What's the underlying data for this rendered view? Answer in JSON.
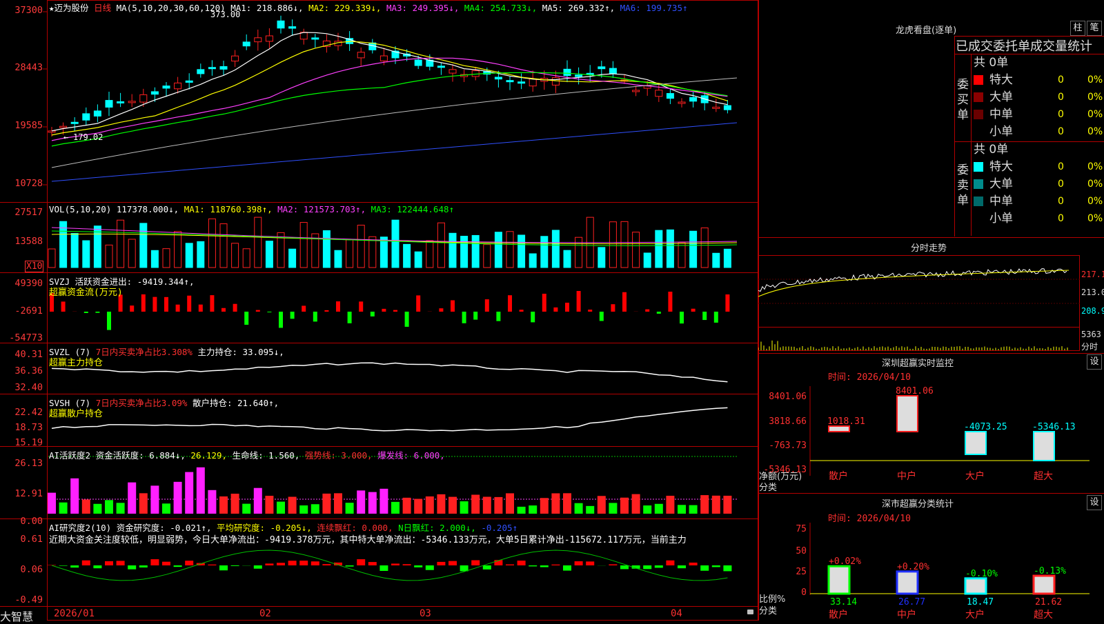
{
  "brand": "大智慧",
  "main": {
    "star": "★",
    "stock_name": "迈为股份",
    "period": "日线",
    "ma_formula": "MA(5,10,20,30,60,120)",
    "ma1": "MA1: 218.886↓,",
    "ma2": "MA2: 229.339↓,",
    "ma3": "MA3: 249.395↓,",
    "ma4": "MA4: 254.733↓,",
    "ma5": "MA5: 269.332↑,",
    "ma6": "MA6: 199.735↑",
    "high_mark": "373.00",
    "low_mark": "179.02",
    "yticks": [
      "37300",
      "28443",
      "19585",
      "10728"
    ]
  },
  "vol": {
    "title": "VOL(5,10,20)",
    "value": "117378.000↓,",
    "ma1": "MA1: 118760.398↑,",
    "ma2": "MA2: 121573.703↑,",
    "ma3": "MA3: 122444.648↑",
    "yticks": [
      "27517",
      "13588"
    ],
    "unit": "X10"
  },
  "svzj": {
    "title": "SVZJ",
    "label": "活跃资金进出: -9419.344↑,",
    "sub": "超赢资金流(万元)",
    "yticks": [
      "49390",
      "-2691",
      "-54773"
    ]
  },
  "svzl": {
    "title": "SVZL (7)",
    "red_label": "7日内买卖净占比3.308%",
    "label": "主力持仓: 33.095↓,",
    "sub": "超赢主力持仓",
    "yticks": [
      "40.31",
      "36.36",
      "32.40"
    ]
  },
  "svsh": {
    "title": "SVSH (7)",
    "red_label": "7日内买卖净占比3.09%",
    "label": "散户持仓: 21.640↑,",
    "sub": "超赢散户持仓",
    "yticks": [
      "22.42",
      "18.73",
      "15.19"
    ]
  },
  "ai1": {
    "title": "AI活跃度2",
    "label": "资金活跃度: 6.884↓,",
    "v2": "26.129,",
    "v3": "生命线: 1.560,",
    "v4": "强势线: 3.000,",
    "v5": "爆发线: 6.000,",
    "yticks": [
      "26.13",
      "12.91",
      "0.00"
    ]
  },
  "ai2": {
    "title": "AI研究度2(10)",
    "label": "资金研究度: -0.021↑,",
    "v2": "平均研究度: -0.205↓,",
    "v3": "连续飘红: 0.000,",
    "v4": "N日飘红: 2.000↓,",
    "v5": "-0.205↑",
    "yticks": [
      "0.61",
      "0.06",
      "-0.49"
    ],
    "comment": "近期大资金关注度较低，明显弱势，今日大单净流出：-9419.378万元，其中特大单净流出：-5346.133万元，大单5日累计净出-115672.117万元，当前主力"
  },
  "xaxis": [
    "2026/01",
    "02",
    "03",
    "04"
  ],
  "lhb": {
    "title": "龙虎看盘(逐单)",
    "btn1": "柱",
    "btn2": "笔",
    "header": "已成交委托单成交量统计",
    "buy_label": "委买单",
    "sell_label": "委卖单",
    "buy_total": "共 0单",
    "sell_total": "共 0单",
    "buy_rows": [
      {
        "name": "特大",
        "count": "0",
        "pct": "0%"
      },
      {
        "name": "大单",
        "count": "0",
        "pct": "0%"
      },
      {
        "name": "中单",
        "count": "0",
        "pct": "0%"
      },
      {
        "name": "小单",
        "count": "0",
        "pct": "0%"
      }
    ],
    "sell_rows": [
      {
        "name": "特大",
        "count": "0",
        "pct": "0%"
      },
      {
        "name": "大单",
        "count": "0",
        "pct": "0%"
      },
      {
        "name": "中单",
        "count": "0",
        "pct": "0%"
      },
      {
        "name": "小单",
        "count": "0",
        "pct": "0%"
      }
    ],
    "buy_colors": [
      "#ff0000",
      "#8b0000",
      "#6a0000",
      "#000000"
    ],
    "sell_colors": [
      "#00ffff",
      "#008b8b",
      "#006a6a",
      "#000000"
    ]
  },
  "fenshi": {
    "title": "分时走势",
    "yticks": [
      "217.1",
      "213.0",
      "208.9"
    ],
    "vol_tick": "5363",
    "vol_label": "分时"
  },
  "szmon": {
    "title": "深圳超赢实时监控",
    "btn": "设",
    "time": "时间: 2026/04/10",
    "yticks": [
      "8401.06",
      "3818.66",
      "-763.73",
      "-5346.13"
    ],
    "ylabel1": "净额(万元)",
    "ylabel2": "分类",
    "bars": [
      {
        "cat": "散户",
        "value": "1018.31"
      },
      {
        "cat": "中户",
        "value": "8401.06"
      },
      {
        "cat": "大户",
        "value": "-4073.25"
      },
      {
        "cat": "超大",
        "value": "-5346.13"
      }
    ]
  },
  "szcls": {
    "title": "深市超赢分类统计",
    "btn": "设",
    "time": "时间: 2026/04/10",
    "yticks": [
      "75",
      "50",
      "25",
      "0"
    ],
    "ylabel1": "比例%",
    "ylabel2": "分类",
    "bars": [
      {
        "cat": "散户",
        "pct": "+0.02%",
        "value": "33.14"
      },
      {
        "cat": "中户",
        "pct": "+0.20%",
        "value": "26.77"
      },
      {
        "cat": "大户",
        "pct": "-0.10%",
        "value": "18.47"
      },
      {
        "cat": "超大",
        "pct": "-0.13%",
        "value": "21.62"
      }
    ]
  }
}
